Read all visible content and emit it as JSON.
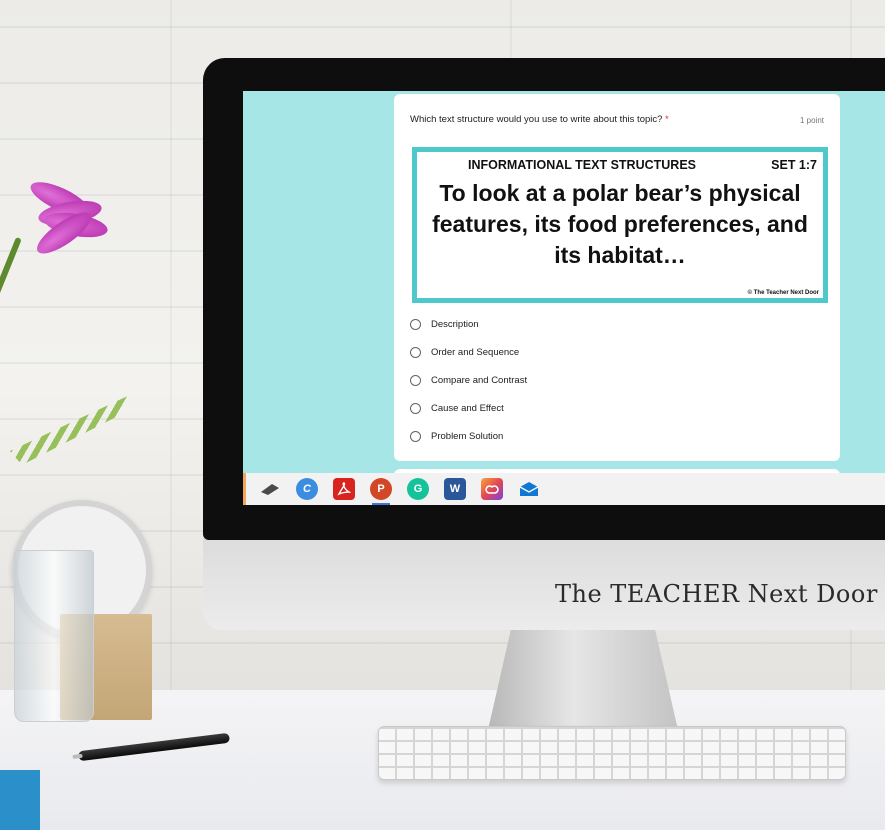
{
  "form": {
    "question": "Which text structure would you use to write about this topic?",
    "required_mark": "*",
    "points": "1 point",
    "image": {
      "title": "INFORMATIONAL TEXT STRUCTURES",
      "set": "SET 1:7",
      "text": "To look at a polar bear’s physical features, its food preferences, and its habitat…",
      "copyright": "© The Teacher Next Door"
    },
    "options": [
      {
        "label": "Description"
      },
      {
        "label": "Order and Sequence"
      },
      {
        "label": "Compare and Contrast"
      },
      {
        "label": "Cause and Effect"
      },
      {
        "label": "Problem Solution"
      }
    ]
  },
  "taskbar": {
    "apps": [
      {
        "icon": "screencast-icon",
        "color": "#4a4a4a"
      },
      {
        "icon": "canva-icon",
        "color": "#3b8de0"
      },
      {
        "icon": "acrobat-icon",
        "color": "#d8231f"
      },
      {
        "icon": "powerpoint-icon",
        "color": "#d24726"
      },
      {
        "icon": "grammarly-icon",
        "color": "#15c39a"
      },
      {
        "icon": "word-icon",
        "color": "#2b579a"
      },
      {
        "icon": "creative-cloud-icon",
        "color": "#e34850"
      },
      {
        "icon": "mail-icon",
        "color": "#0f78d4"
      }
    ]
  },
  "monitor": {
    "brand": "The TEACHER Next Door"
  }
}
